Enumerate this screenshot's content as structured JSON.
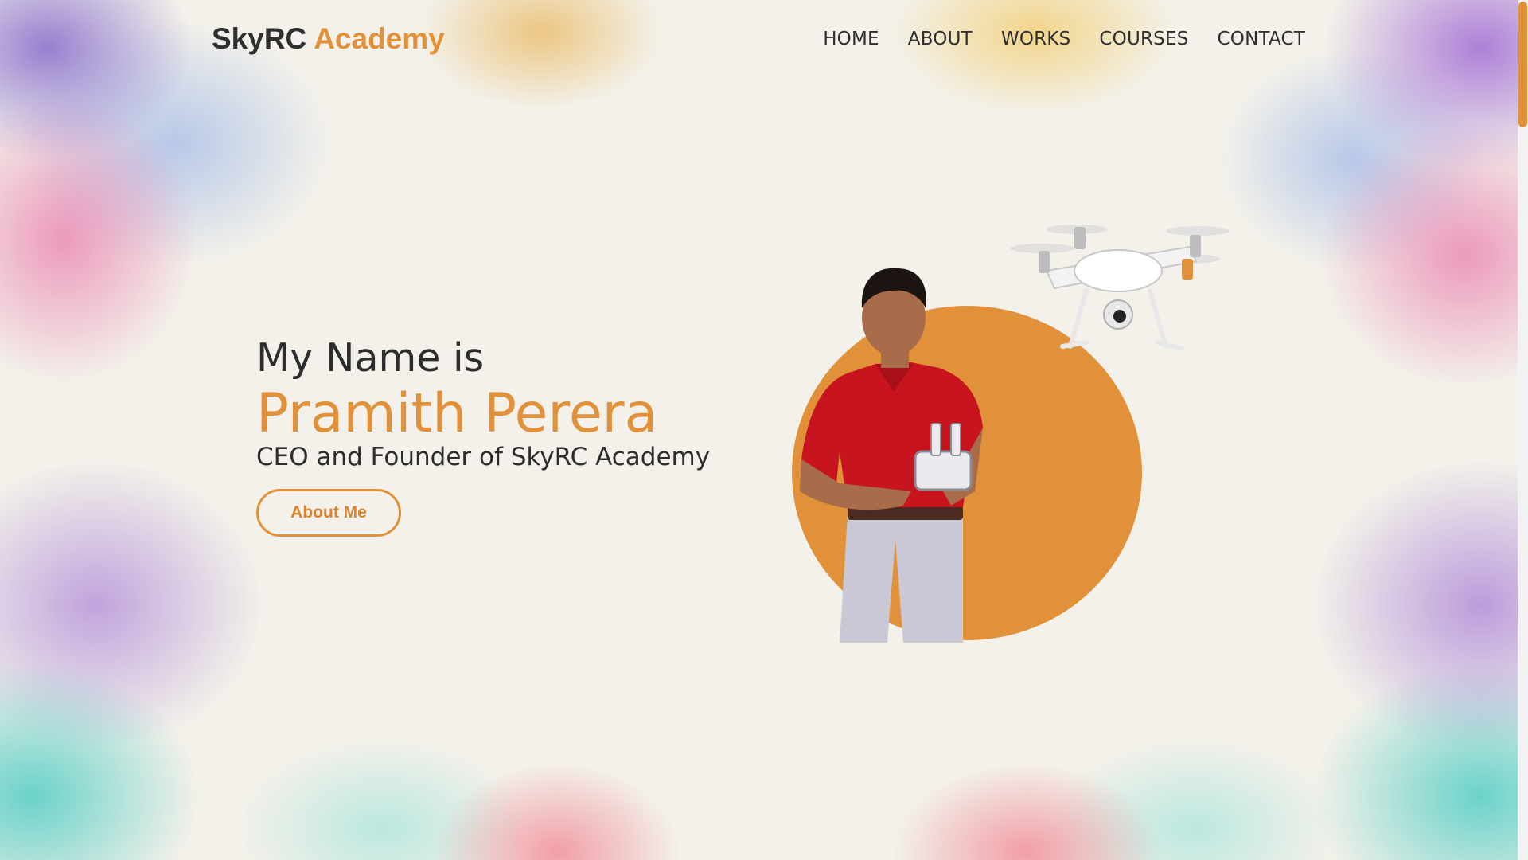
{
  "brand": {
    "part1": "SkyRC",
    "part2": "Academy"
  },
  "nav": {
    "items": [
      "HOME",
      "ABOUT",
      "WORKS",
      "COURSES",
      "CONTACT"
    ]
  },
  "hero": {
    "intro": "My Name is",
    "name": "Pramith Perera",
    "role": "CEO and Founder of SkyRC Academy",
    "button": "About Me"
  },
  "colors": {
    "accent": "#e0913a",
    "text": "#2d2d2d",
    "background": "#f3f1ea"
  },
  "icons": {
    "portrait": "person-photo",
    "drone": "drone-image"
  }
}
